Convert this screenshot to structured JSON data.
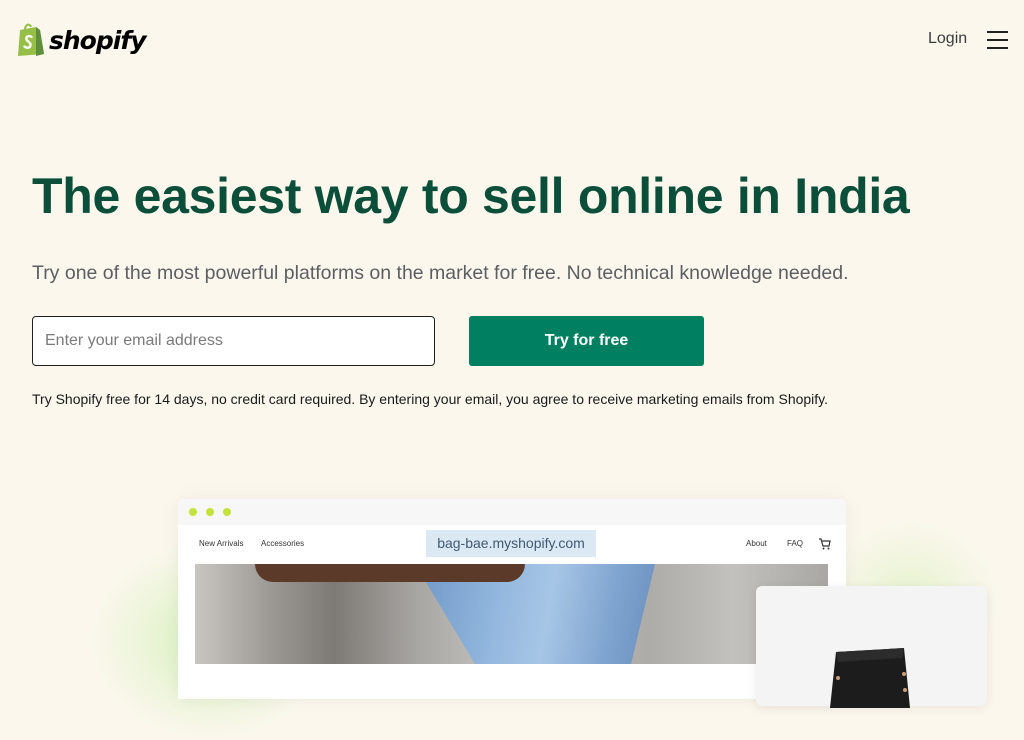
{
  "header": {
    "brand": "shopify",
    "login_label": "Login",
    "menu_icon": "hamburger-menu-icon"
  },
  "hero": {
    "title": "The easiest way to sell online in India",
    "subtitle": "Try one of the most powerful platforms on the market for free. No technical knowledge needed.",
    "email_placeholder": "Enter your email address",
    "email_value": "",
    "cta_label": "Try for free",
    "disclaimer": "Try Shopify free for 14 days, no credit card required. By entering your email, you agree to receive marketing emails from Shopify."
  },
  "preview": {
    "nav_left": [
      "New Arrivals",
      "Accessories"
    ],
    "url": "bag-bae.myshopify.com",
    "nav_right": [
      "About",
      "FAQ"
    ],
    "cart_icon": "cart-icon"
  },
  "colors": {
    "background": "#fbf7ed",
    "title_green": "#0b4f3b",
    "button_green": "#008060",
    "logo_green": "#95bf47",
    "browser_dots": "#c4e33a"
  }
}
